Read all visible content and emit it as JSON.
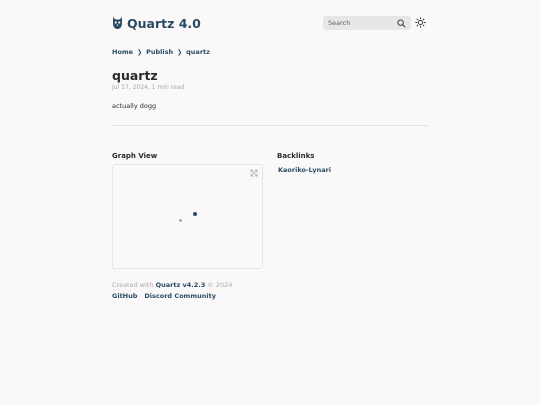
{
  "header": {
    "site_title": "Quartz 4.0",
    "logo_icon": "quartz-owl-icon",
    "search_placeholder": "Search",
    "search_icon": "search-icon",
    "theme_icon": "sun-icon"
  },
  "breadcrumb": {
    "items": [
      "Home",
      "Publish",
      "quartz"
    ],
    "separator": "❯"
  },
  "article": {
    "title": "quartz",
    "date": "Jul 17, 2024,",
    "read_time": "1 min read",
    "body": "actually dogg"
  },
  "graph": {
    "title": "Graph View",
    "expand_icon": "expand-icon",
    "nodes": [
      {
        "role": "current",
        "color": "#284b63"
      },
      {
        "role": "neighbor",
        "color": "#a8a8a8"
      }
    ]
  },
  "backlinks": {
    "title": "Backlinks",
    "items": [
      "Kaoriko-Lynari"
    ]
  },
  "footer": {
    "created_with": "Created with",
    "quartz_link": "Quartz v4.2.3",
    "copyright": "© 2024",
    "links": [
      "GitHub",
      "Discord Community"
    ]
  },
  "colors": {
    "background": "#faf8f8",
    "accent": "#284b63",
    "muted": "#a8a8a8"
  }
}
